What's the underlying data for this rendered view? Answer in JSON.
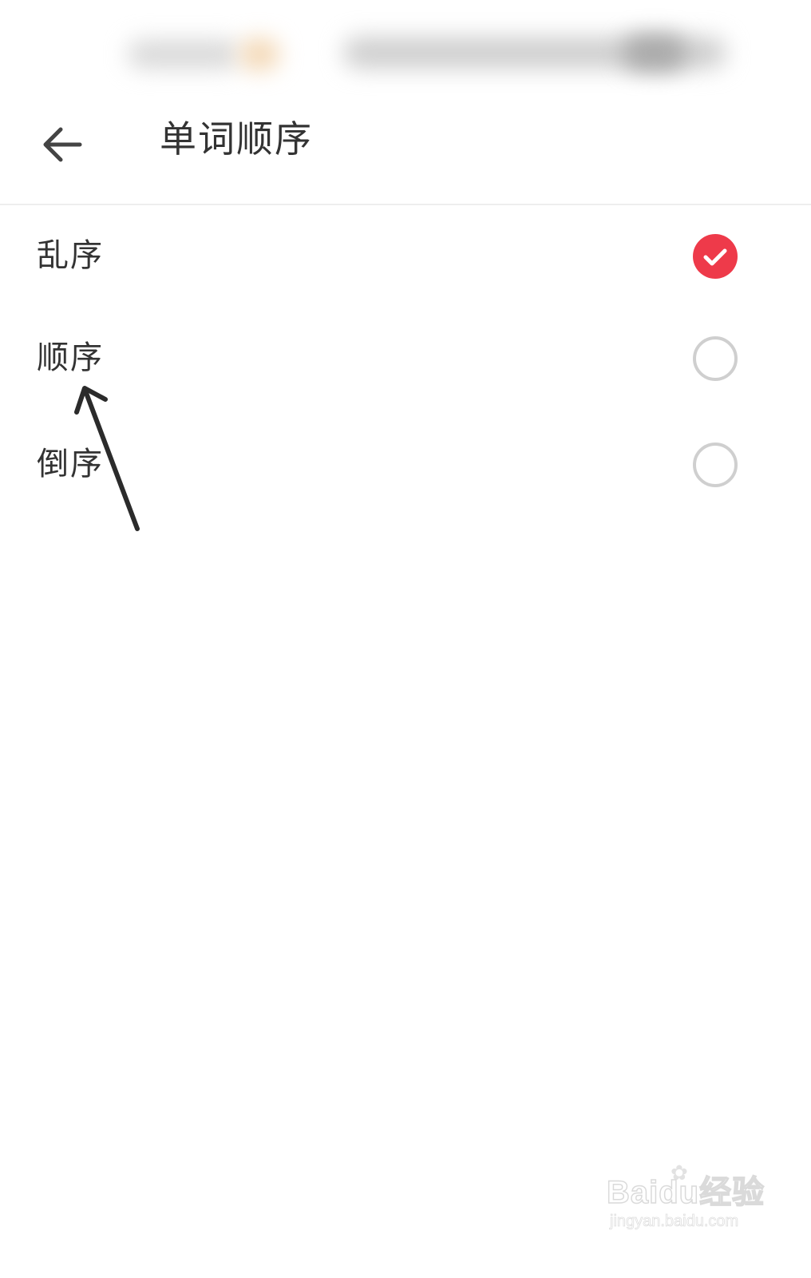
{
  "header": {
    "title": "单词顺序",
    "back_icon": "arrow-left-icon"
  },
  "options": [
    {
      "label": "乱序",
      "selected": true
    },
    {
      "label": "顺序",
      "selected": false
    },
    {
      "label": "倒序",
      "selected": false
    }
  ],
  "colors": {
    "accent": "#ee3a4a",
    "radio_border": "#cfcfcf",
    "text": "#333333",
    "divider": "#eeeeee"
  },
  "icons": {
    "checked": "check-circle-icon",
    "unchecked": "radio-empty-icon",
    "annotation": "annotation-arrow-icon"
  },
  "watermark": {
    "logo": "Baidu经验",
    "url": "jingyan.baidu.com"
  }
}
